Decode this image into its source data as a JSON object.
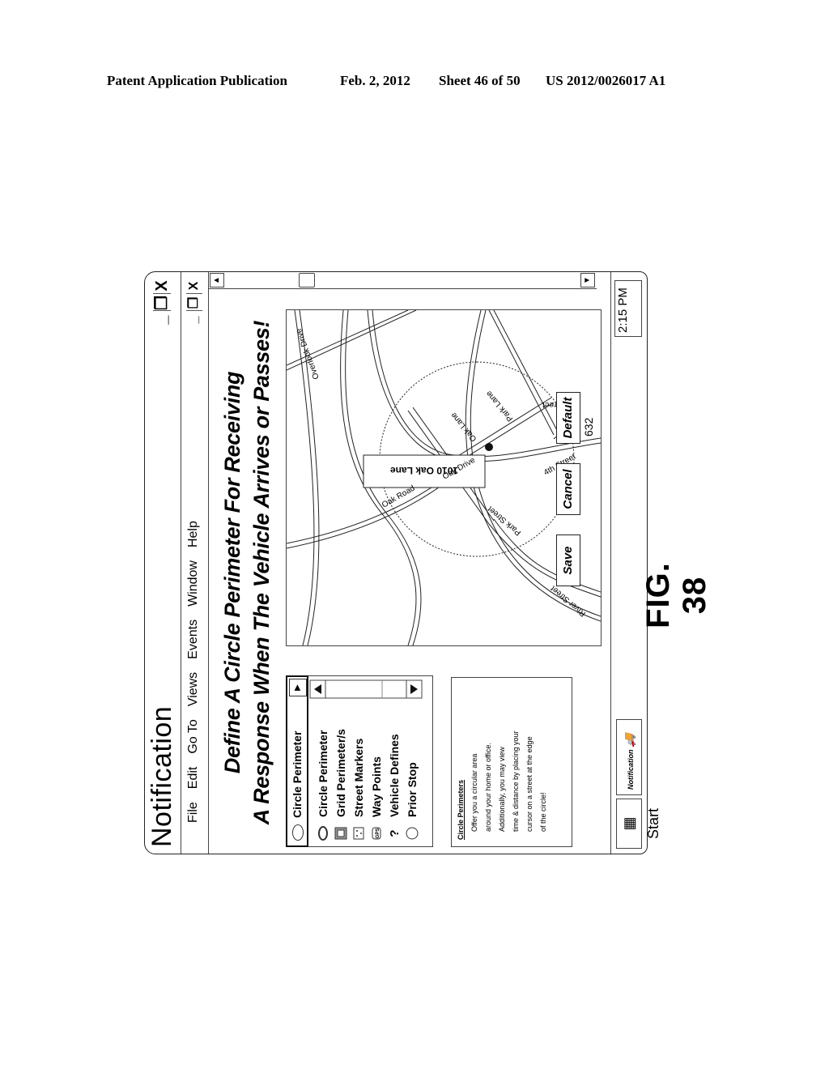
{
  "header": {
    "publication": "Patent Application Publication",
    "date": "Feb. 2, 2012",
    "sheet": "Sheet 46 of 50",
    "number": "US 2012/0026017 A1"
  },
  "window": {
    "title": "Notification",
    "controls": {
      "minimize": "_",
      "restore": "❐",
      "close": "X"
    },
    "menu": [
      "File",
      "Edit",
      "Go To",
      "Views",
      "Events",
      "Window",
      "Help"
    ]
  },
  "heading": {
    "line1": "Define A Circle Perimeter For Receiving",
    "line2": "A Response When The Vehicle Arrives or Passes!"
  },
  "dropdown": {
    "selected": "Circle Perimeter",
    "icon": "ellipse-icon"
  },
  "options": [
    {
      "label": "Circle Perimeter",
      "icon": "ellipse-icon"
    },
    {
      "label": "Grid Perimeter/s",
      "icon": "grid-square-icon"
    },
    {
      "label": "Street Markers",
      "icon": "street-markers-icon"
    },
    {
      "label": "Way Points",
      "icon": "gps-icon"
    },
    {
      "label": "Vehicle Defines",
      "icon": "question-icon"
    },
    {
      "label": "Prior Stop",
      "icon": "circle-icon"
    }
  ],
  "info": {
    "title": "Circle Perimeters",
    "lines": [
      "Offer you a circular area",
      "around your home or office.",
      "Additionally, you may view",
      "time & distance by placing your",
      "cursor on a street at the edge",
      "of the circle!"
    ]
  },
  "map": {
    "callout": "1010 Oak Lane",
    "reference": "632",
    "streets": [
      "Overlook Drive",
      "Oak Road",
      "Oak Drive",
      "Oak Lane",
      "Park Lane",
      "Park Street",
      "4th Street",
      "3rd Street",
      "River Street"
    ]
  },
  "buttons": {
    "save": "Save",
    "cancel": "Cancel",
    "default": "Default"
  },
  "taskbar": {
    "start": "Start",
    "task": "Notification",
    "clock": "2:15 PM"
  },
  "figure": "FIG. 38"
}
